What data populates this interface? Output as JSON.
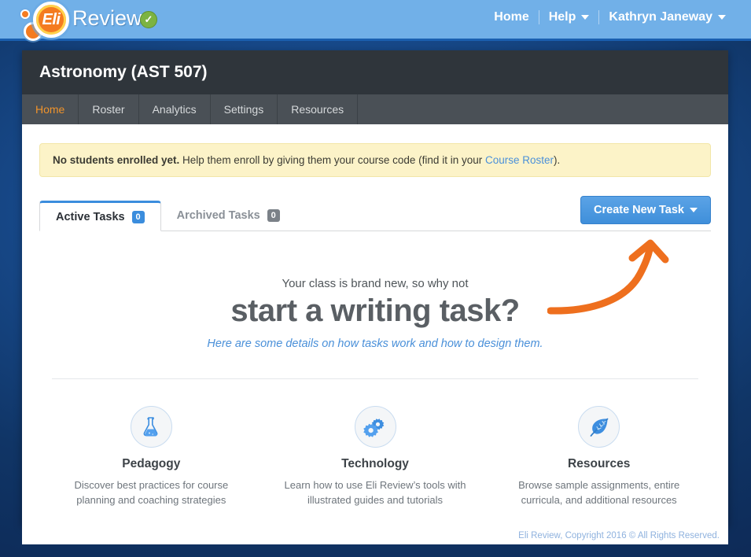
{
  "topbar": {
    "logo_eli": "Eli",
    "logo_review": "Review",
    "verified_icon": "verified-check-icon",
    "nav": [
      {
        "label": "Home",
        "has_caret": false
      },
      {
        "label": "Help",
        "has_caret": true
      },
      {
        "label": "Kathryn Janeway",
        "has_caret": true
      }
    ]
  },
  "course": {
    "title": "Astronomy (AST 507)",
    "nav": [
      {
        "label": "Home",
        "active": true
      },
      {
        "label": "Roster",
        "active": false
      },
      {
        "label": "Analytics",
        "active": false
      },
      {
        "label": "Settings",
        "active": false
      },
      {
        "label": "Resources",
        "active": false
      }
    ]
  },
  "alert": {
    "bold": "No students enrolled yet.",
    "text_before": " Help them enroll by giving them your course code (find it in your ",
    "link": "Course Roster",
    "text_after": ")."
  },
  "tabs": {
    "active_tasks": {
      "label": "Active Tasks",
      "count": "0"
    },
    "archived_tasks": {
      "label": "Archived Tasks",
      "count": "0"
    },
    "create_button": "Create New Task"
  },
  "hero": {
    "pre": "Your class is brand new, so why not",
    "main": "start a writing task?",
    "link": "Here are some details on how tasks work and how to design them.",
    "arrow_icon": "curved-arrow-icon"
  },
  "features": [
    {
      "icon": "flask-icon",
      "title": "Pedagogy",
      "desc": "Discover best practices for course planning and coaching strategies"
    },
    {
      "icon": "gears-icon",
      "title": "Technology",
      "desc": "Learn how to use Eli Review’s tools with illustrated guides and tutorials"
    },
    {
      "icon": "leaf-icon",
      "title": "Resources",
      "desc": "Browse sample assignments, entire curricula, and additional resources"
    }
  ],
  "footer": {
    "text": "Eli Review, Copyright 2016 © All Rights Reserved."
  },
  "colors": {
    "topbar_blue": "#71b0e8",
    "page_blue": "#10356a",
    "accent_orange": "#f0932b",
    "brand_orange": "#f47b20",
    "link_blue": "#4a90d9",
    "button_blue": "#4a97e0",
    "header_dark": "#2f353b",
    "nav_gray": "#4a5056",
    "alert_yellow": "#fcf3c8",
    "badge_blue": "#3b8ddd",
    "badge_gray": "#7b8188",
    "check_green": "#7cb342"
  }
}
